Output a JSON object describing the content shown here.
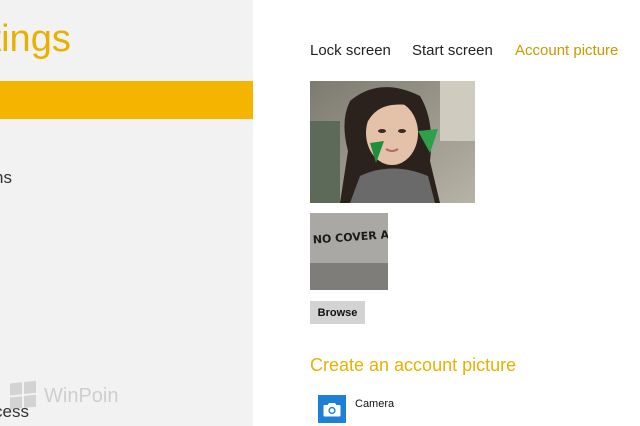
{
  "left_pane": {
    "title": "ttings",
    "nav_item_fragment": "ns",
    "bottom_item_fragment": "cess",
    "watermark": "WinPoin"
  },
  "tabs": [
    {
      "label": "Lock screen",
      "selected": false
    },
    {
      "label": "Start screen",
      "selected": false
    },
    {
      "label": "Account picture",
      "selected": true
    }
  ],
  "previous_picture_text": "NO COVER AVAIBLE",
  "browse_label": "Browse",
  "create": {
    "heading": "Create an account picture",
    "camera_label": "Camera"
  },
  "colors": {
    "accent": "#f4b400",
    "accent_text": "#e8b100",
    "camera_tile": "#1e7fd6"
  },
  "icons": {
    "camera": "camera-icon",
    "watermark_logo": "windows-logo-icon"
  }
}
